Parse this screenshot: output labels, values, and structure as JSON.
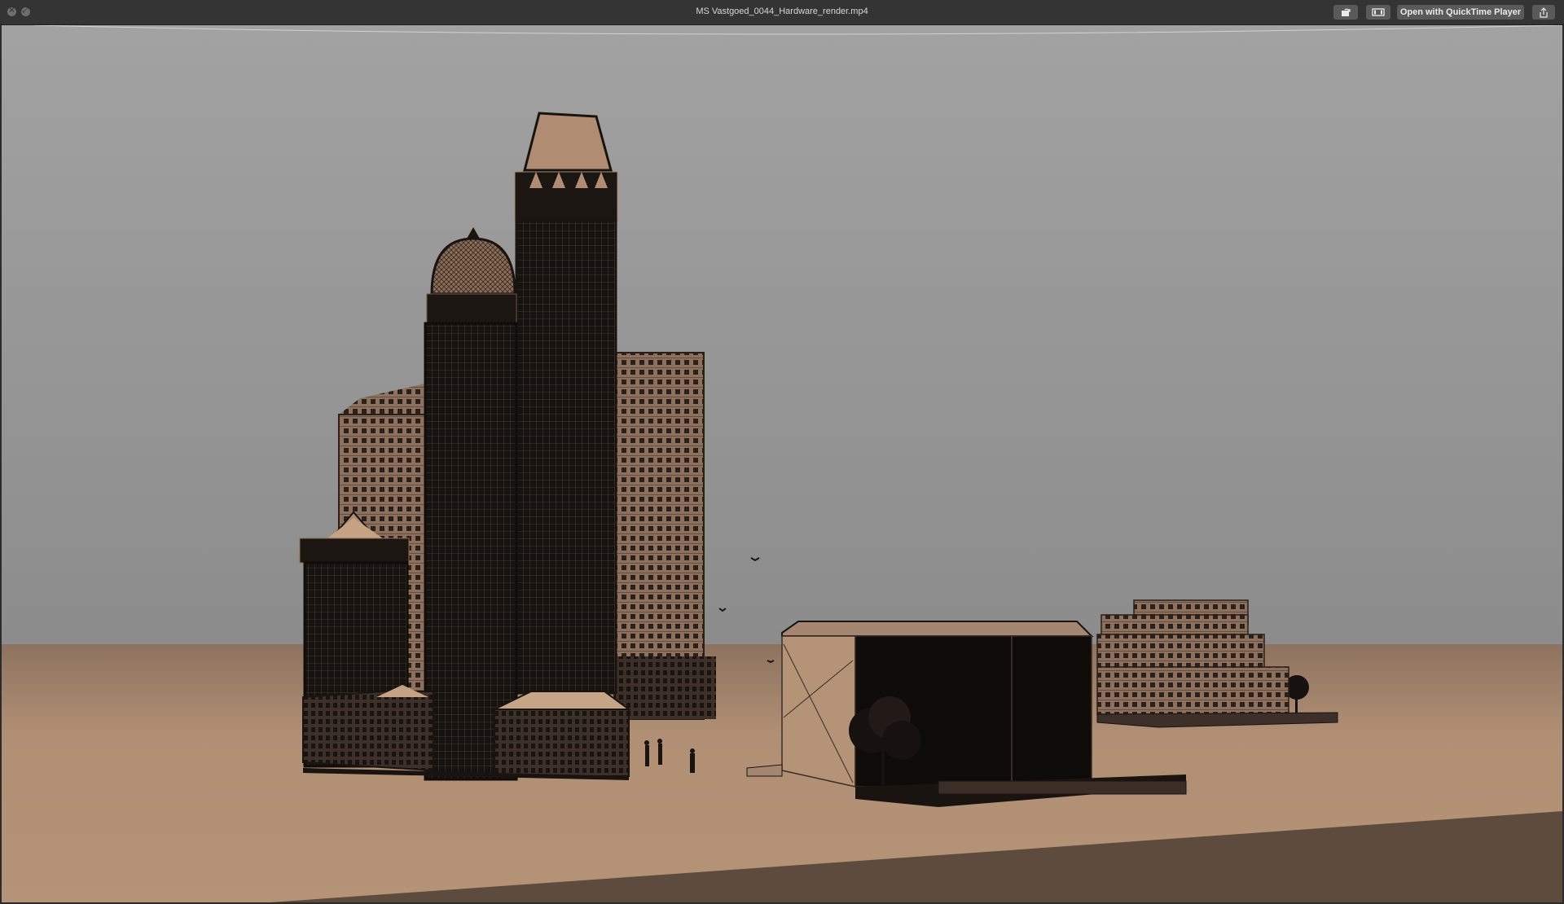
{
  "window": {
    "title": "MS Vastgoed_0044_Hardware_render.mp4",
    "open_button_label": "Open with QuickTime Player"
  },
  "icons": {
    "close": "close-icon",
    "fullscreen": "fullscreen-icon",
    "rotate": "rotate-icon",
    "trim": "trim-icon",
    "share": "share-icon"
  },
  "colors": {
    "titlebar": "#343434",
    "sky": "#9a9a9a",
    "ground": "#b08e73",
    "building_dark": "#151110",
    "building_light": "#8a6e5a"
  }
}
